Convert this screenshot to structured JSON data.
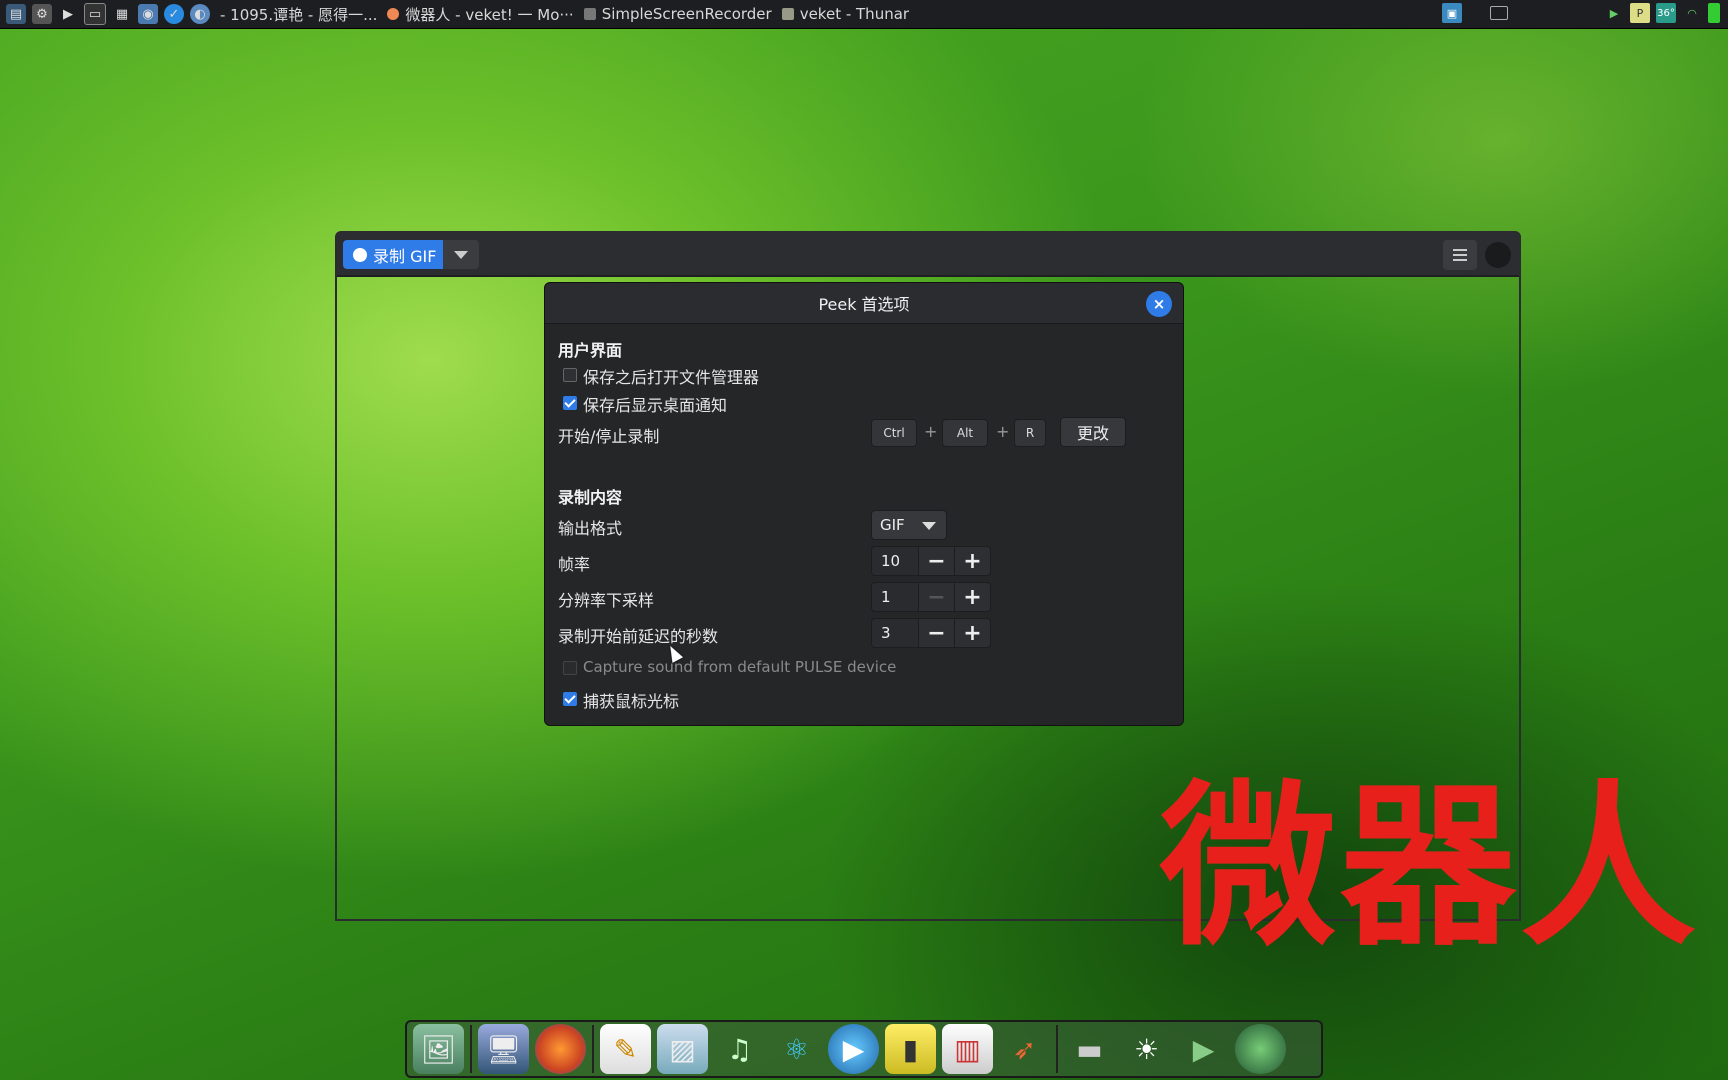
{
  "topbar": {
    "tasks": [
      {
        "label": "- 1095.谭艳 - 愿得一...",
        "color": "#c46"
      },
      {
        "label": "微器人 - veket! 一 Mo···",
        "color": "#e85"
      },
      {
        "label": "SimpleScreenRecorder",
        "color": "#888"
      },
      {
        "label": "veket - Thunar",
        "color": "#aa8"
      }
    ],
    "temperature": "36°"
  },
  "peek": {
    "record_label": "录制 GIF"
  },
  "dialog": {
    "title": "Peek 首选项",
    "close_glyph": "×",
    "ui_section": "用户界面",
    "open_fm_label": "保存之后打开文件管理器",
    "open_fm_checked": false,
    "notify_label": "保存后显示桌面通知",
    "notify_checked": true,
    "hotkey_label": "开始/停止录制",
    "keys": [
      "Ctrl",
      "Alt",
      "R"
    ],
    "plus": "+",
    "change_label": "更改",
    "content_section": "录制内容",
    "format_label": "输出格式",
    "format_value": "GIF",
    "framerate_label": "帧率",
    "framerate_value": "10",
    "downsample_label": "分辨率下采样",
    "downsample_value": "1",
    "delay_label": "录制开始前延迟的秒数",
    "delay_value": "3",
    "minus": "−",
    "plus_btn": "+",
    "sound_label": "Capture sound from default PULSE device",
    "sound_checked": false,
    "cursor_label": "捕获鼠标光标",
    "cursor_checked": true
  },
  "watermark": "微器人",
  "dock": {
    "icons": [
      "desktop-icon",
      "monitor-icon",
      "browser-icon",
      "notepad-icon",
      "image-viewer-icon",
      "music-icon",
      "atom-icon",
      "media-player-icon",
      "file-manager-icon",
      "chart-icon",
      "launcher-icon",
      "drive-icon",
      "brightness-icon",
      "play-icon",
      "globe-icon"
    ]
  },
  "colors": {
    "accent": "#2f7ce8",
    "watermark": "#e8201c"
  }
}
